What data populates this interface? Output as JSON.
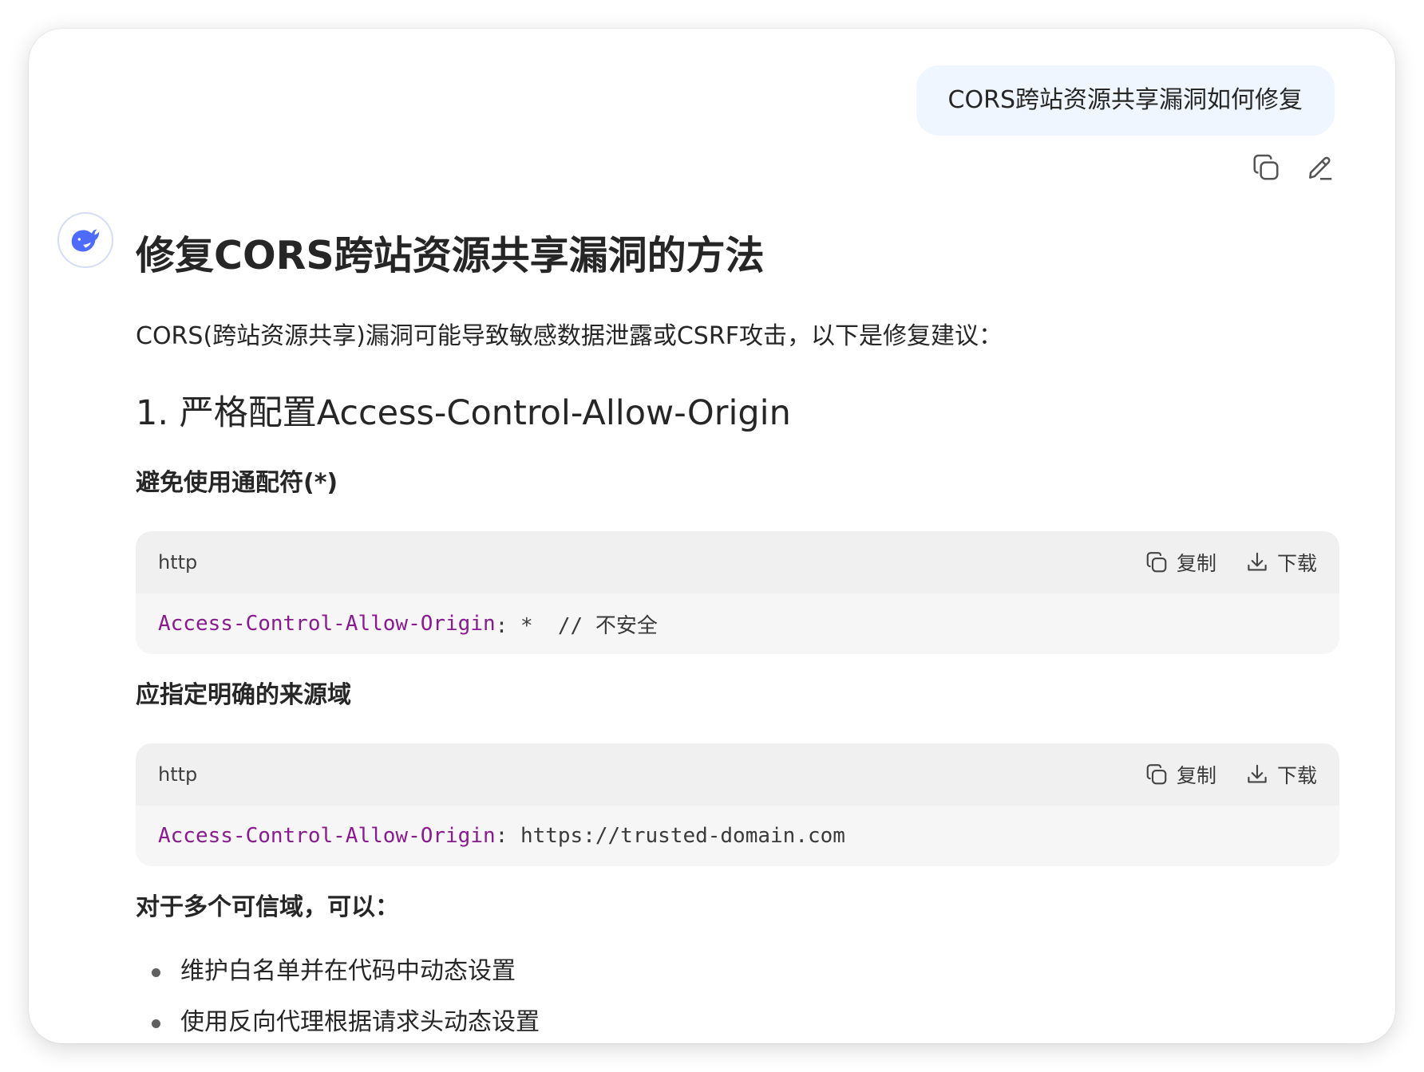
{
  "user_message": {
    "text": "CORS跨站资源共享漏洞如何修复"
  },
  "message_actions": {
    "copy_icon": "copy-icon",
    "edit_icon": "edit-icon"
  },
  "assistant": {
    "avatar_icon": "whale-logo-icon",
    "title": "修复CORS跨站资源共享漏洞的方法",
    "intro": "CORS(跨站资源共享)漏洞可能导致敏感数据泄露或CSRF攻击，以下是修复建议：",
    "section1_heading": "1. 严格配置Access-Control-Allow-Origin",
    "sub1": "避免使用通配符(*)",
    "code1": {
      "lang": "http",
      "copy_label": "复制",
      "download_label": "下载",
      "key": "Access-Control-Allow-Origin",
      "rest": ": *  // 不安全"
    },
    "sub2": "应指定明确的来源域",
    "code2": {
      "lang": "http",
      "copy_label": "复制",
      "download_label": "下载",
      "key": "Access-Control-Allow-Origin",
      "rest": ": https://trusted-domain.com"
    },
    "sub3": "对于多个可信域，可以：",
    "bullets": [
      "维护白名单并在代码中动态设置",
      "使用反向代理根据请求头动态设置"
    ]
  },
  "colors": {
    "user_bubble": "#eff6ff",
    "code_keyword": "#8a1a8f",
    "avatar_accent": "#4d6bfe"
  }
}
